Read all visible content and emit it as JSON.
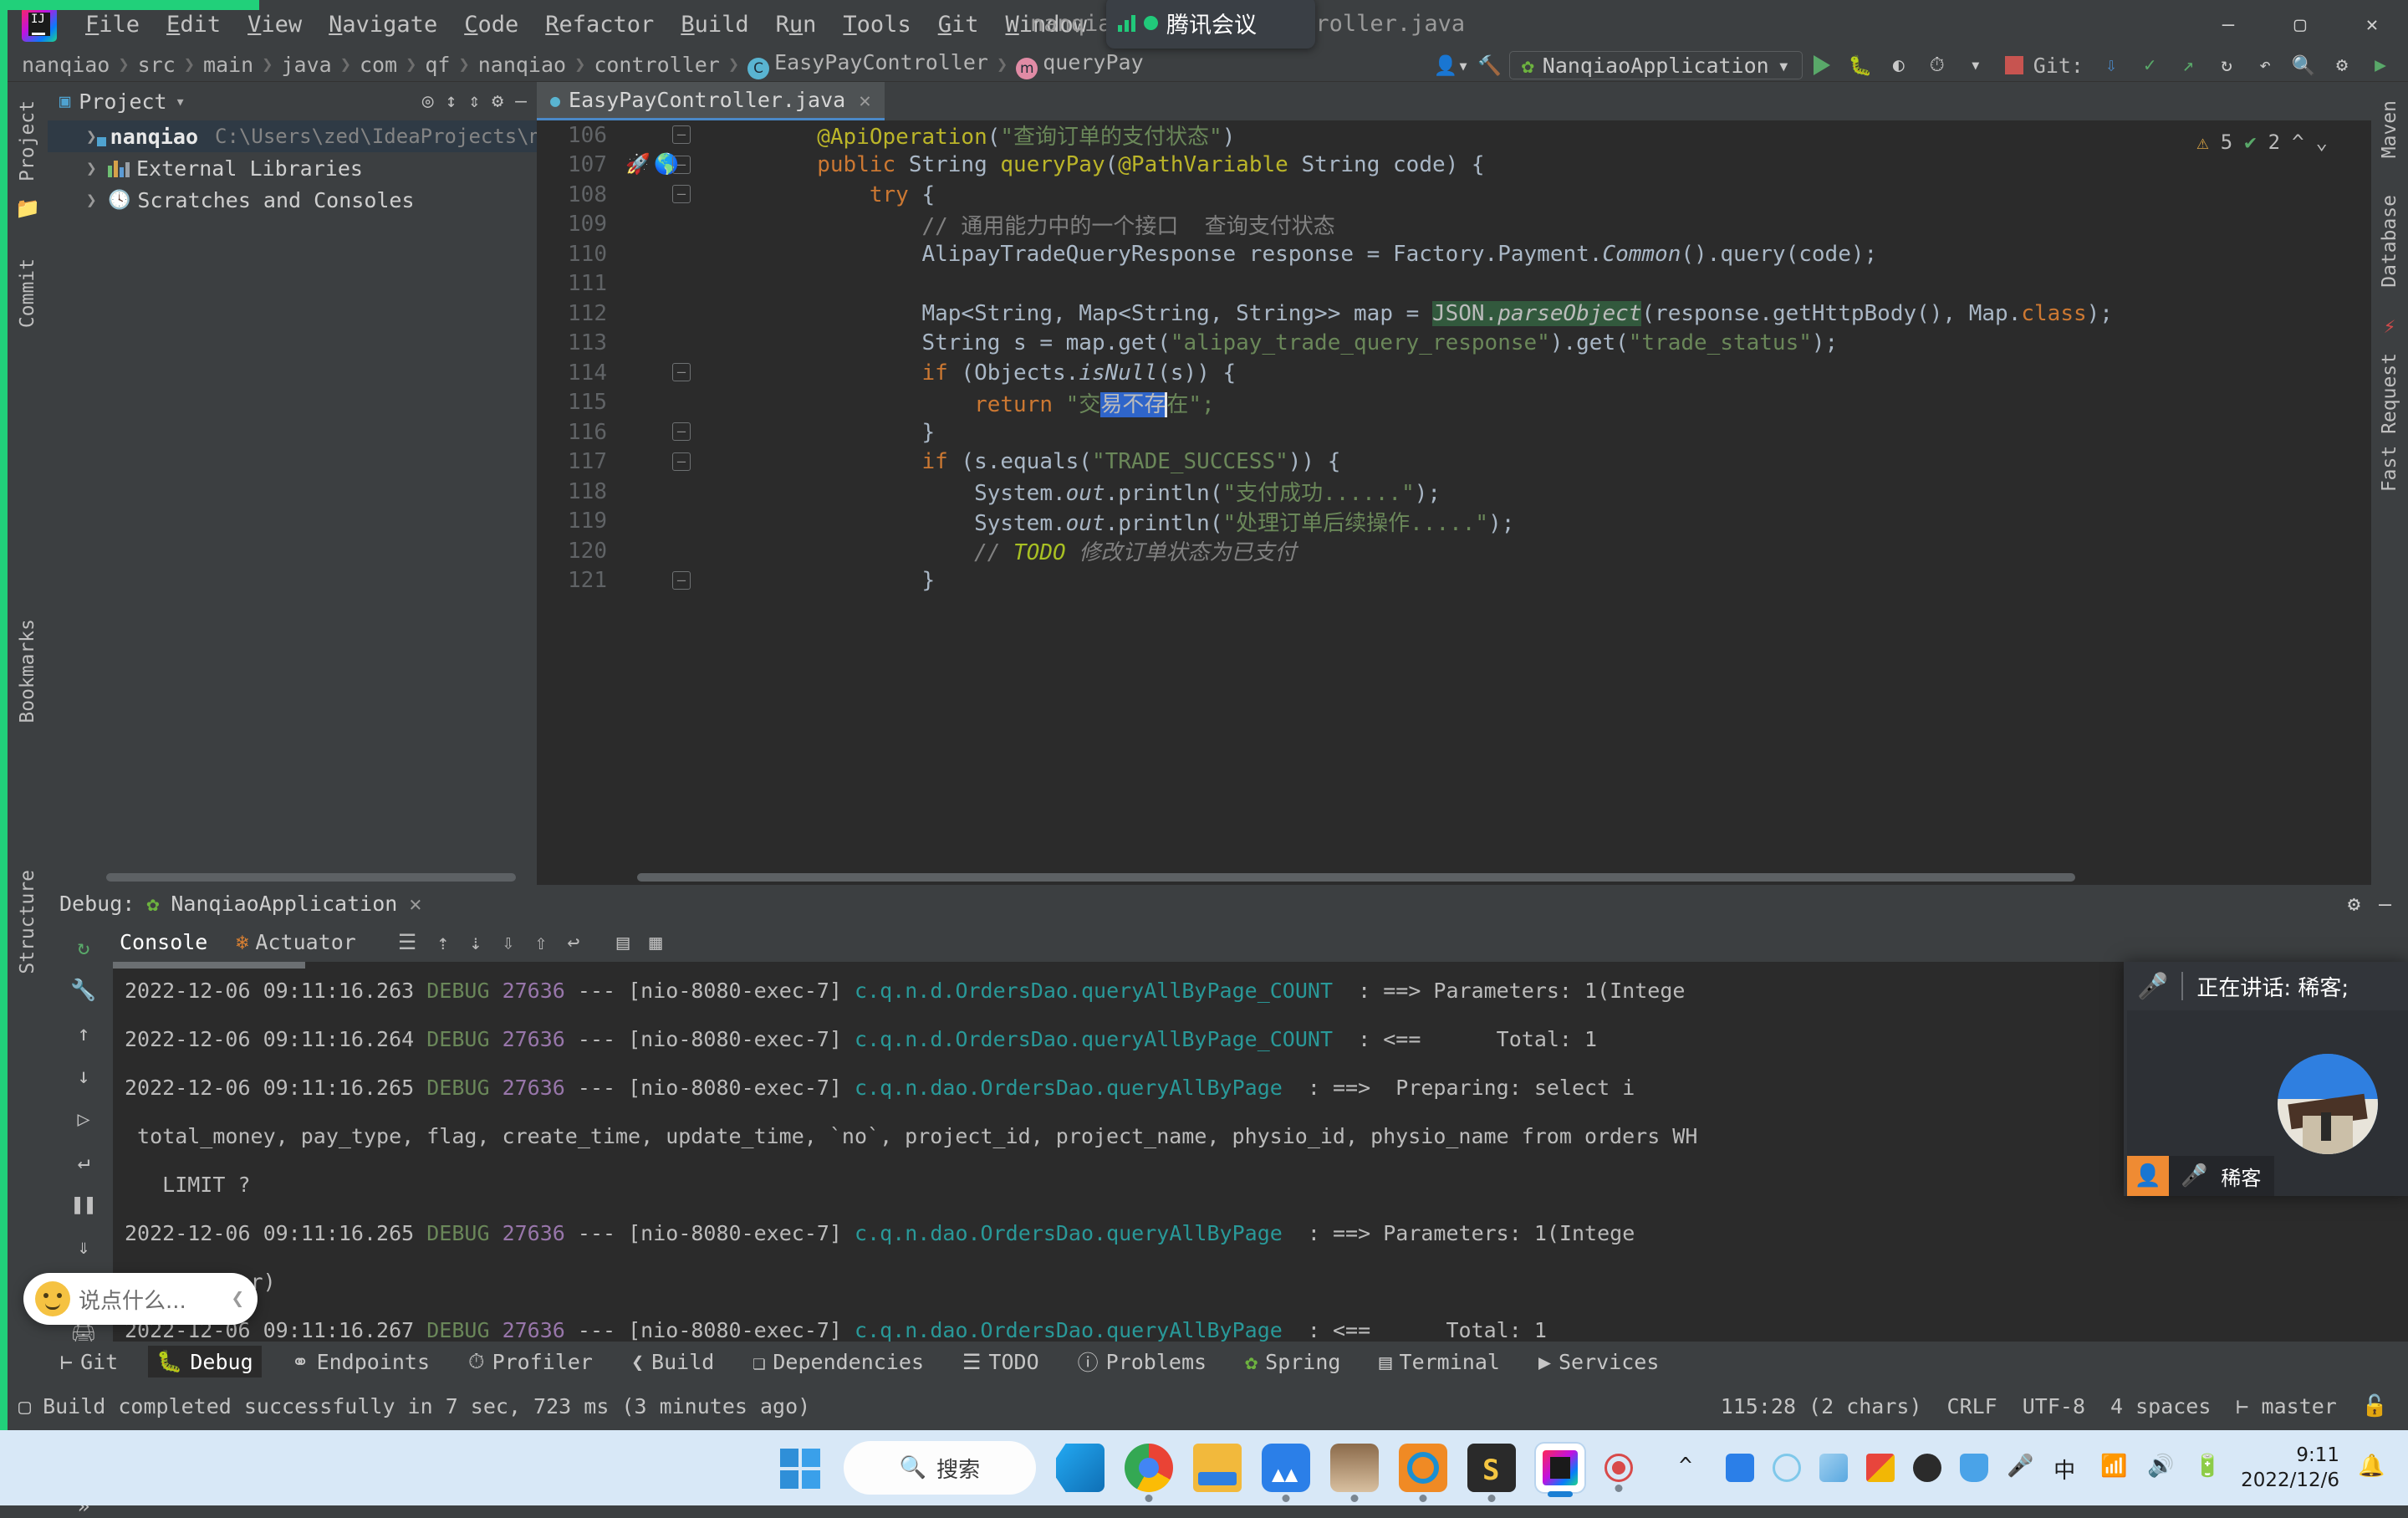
{
  "window": {
    "title": "nanqiao – EasyPayController.java",
    "project_name": "nanqiao",
    "file_name": "EasyPayController.java",
    "minimize": "—",
    "maximize": "▢",
    "close": "✕"
  },
  "menu": {
    "items": [
      {
        "label": "File",
        "mnemonic": "F"
      },
      {
        "label": "Edit",
        "mnemonic": "E"
      },
      {
        "label": "View",
        "mnemonic": "V"
      },
      {
        "label": "Navigate",
        "mnemonic": "N"
      },
      {
        "label": "Code",
        "mnemonic": "C"
      },
      {
        "label": "Refactor",
        "mnemonic": "R"
      },
      {
        "label": "Build",
        "mnemonic": "B"
      },
      {
        "label": "Run",
        "mnemonic": "u"
      },
      {
        "label": "Tools",
        "mnemonic": "T"
      },
      {
        "label": "Git",
        "mnemonic": "G"
      },
      {
        "label": "Window",
        "mnemonic": "W"
      },
      {
        "label": "Help",
        "mnemonic": "H"
      }
    ]
  },
  "tencent_pill": {
    "app_name": "腾讯会议"
  },
  "navbar": {
    "breadcrumbs": [
      "nanqiao",
      "src",
      "main",
      "java",
      "com",
      "qf",
      "nanqiao",
      "controller"
    ],
    "class_crumb": "EasyPayController",
    "class_icon_letter": "C",
    "method_crumb": "queryPay",
    "method_icon_letter": "m",
    "run_config": "NanqiaoApplication",
    "git_label": "Git:",
    "separator": "❯"
  },
  "left_strip": {
    "items": [
      "Project",
      "Commit"
    ]
  },
  "right_strip": {
    "items": [
      "Maven",
      "Database",
      "Fast Request"
    ]
  },
  "bookmarks_strip": {
    "items": [
      "Bookmarks",
      "Structure"
    ]
  },
  "project_panel": {
    "title": "Project",
    "tree": [
      {
        "label": "nanqiao",
        "detail": "C:\\Users\\zed\\IdeaProjects\\na",
        "selected": true,
        "icon": "module-icon"
      },
      {
        "label": "External Libraries",
        "detail": "",
        "selected": false,
        "icon": "libraries-icon"
      },
      {
        "label": "Scratches and Consoles",
        "detail": "",
        "selected": false,
        "icon": "scratches-icon"
      }
    ]
  },
  "editor": {
    "tab_label": "EasyPayController.java",
    "warnings": "5",
    "checks": "2",
    "warn_icon": "⚠",
    "check_icon": "✔",
    "lines": [
      {
        "num": "106",
        "fold": "minus",
        "gutter": "",
        "tokens": [
          {
            "t": "        ",
            "c": "id"
          },
          {
            "t": "@ApiOperation",
            "c": "anno"
          },
          {
            "t": "(",
            "c": "id"
          },
          {
            "t": "\"查询订单的支付状态\"",
            "c": "str"
          },
          {
            "t": ")",
            "c": "id"
          }
        ]
      },
      {
        "num": "107",
        "fold": "minus",
        "gutter": "rocket-globe",
        "tokens": [
          {
            "t": "        ",
            "c": "id"
          },
          {
            "t": "public ",
            "c": "kw"
          },
          {
            "t": "String ",
            "c": "id"
          },
          {
            "t": "queryPay",
            "c": "anno"
          },
          {
            "t": "(",
            "c": "id"
          },
          {
            "t": "@PathVariable ",
            "c": "anno"
          },
          {
            "t": "String code) {",
            "c": "id"
          }
        ]
      },
      {
        "num": "108",
        "fold": "minus",
        "gutter": "",
        "tokens": [
          {
            "t": "            ",
            "c": "id"
          },
          {
            "t": "try",
            "c": "kw"
          },
          {
            "t": " {",
            "c": "id"
          }
        ]
      },
      {
        "num": "109",
        "fold": "",
        "gutter": "",
        "tokens": [
          {
            "t": "                ",
            "c": "id"
          },
          {
            "t": "// 通用能力中的一个接口  查询支付状态",
            "c": "cmt"
          }
        ]
      },
      {
        "num": "110",
        "fold": "",
        "gutter": "",
        "tokens": [
          {
            "t": "                AlipayTradeQueryResponse response = Factory.Payment.",
            "c": "id"
          },
          {
            "t": "Common",
            "c": "stat"
          },
          {
            "t": "().query(code);",
            "c": "id"
          }
        ]
      },
      {
        "num": "111",
        "fold": "",
        "gutter": "",
        "tokens": [
          {
            "t": "",
            "c": "id"
          }
        ]
      },
      {
        "num": "112",
        "fold": "",
        "gutter": "",
        "tokens": [
          {
            "t": "                Map<String, Map<String, String>> map = ",
            "c": "id"
          },
          {
            "t": "JSON.",
            "c": "hl"
          },
          {
            "t": "parseObject",
            "c": "hl-i"
          },
          {
            "t": "(response.getHttpBody(), Map.",
            "c": "id"
          },
          {
            "t": "class",
            "c": "kw"
          },
          {
            "t": ");",
            "c": "id"
          }
        ]
      },
      {
        "num": "113",
        "fold": "",
        "gutter": "",
        "tokens": [
          {
            "t": "                String s = map.get(",
            "c": "id"
          },
          {
            "t": "\"alipay_trade_query_response\"",
            "c": "str"
          },
          {
            "t": ").get(",
            "c": "id"
          },
          {
            "t": "\"trade_status\"",
            "c": "str"
          },
          {
            "t": ");",
            "c": "id"
          }
        ]
      },
      {
        "num": "114",
        "fold": "minus",
        "gutter": "",
        "tokens": [
          {
            "t": "                ",
            "c": "id"
          },
          {
            "t": "if",
            "c": "kw"
          },
          {
            "t": " (Objects.",
            "c": "id"
          },
          {
            "t": "isNull",
            "c": "stat"
          },
          {
            "t": "(s)) {",
            "c": "id"
          }
        ]
      },
      {
        "num": "115",
        "fold": "",
        "gutter": "",
        "current": true,
        "tokens": [
          {
            "t": "                    ",
            "c": "id"
          },
          {
            "t": "return",
            "c": "kw"
          },
          {
            "t": " \"交",
            "c": "str"
          },
          {
            "t": "易不存",
            "c": "sel"
          },
          {
            "t": "caret",
            "c": "caret"
          },
          {
            "t": "在\";",
            "c": "str"
          }
        ]
      },
      {
        "num": "116",
        "fold": "minus",
        "gutter": "",
        "tokens": [
          {
            "t": "                }",
            "c": "id"
          }
        ]
      },
      {
        "num": "117",
        "fold": "minus",
        "gutter": "",
        "tokens": [
          {
            "t": "                ",
            "c": "id"
          },
          {
            "t": "if",
            "c": "kw"
          },
          {
            "t": " (s.equals(",
            "c": "id"
          },
          {
            "t": "\"TRADE_SUCCESS\"",
            "c": "str"
          },
          {
            "t": ")) {",
            "c": "id"
          }
        ]
      },
      {
        "num": "118",
        "fold": "",
        "gutter": "",
        "tokens": [
          {
            "t": "                    System.",
            "c": "id"
          },
          {
            "t": "out",
            "c": "stat"
          },
          {
            "t": ".println(",
            "c": "id"
          },
          {
            "t": "\"支付成功......\"",
            "c": "str"
          },
          {
            "t": ");",
            "c": "id"
          }
        ]
      },
      {
        "num": "119",
        "fold": "",
        "gutter": "",
        "tokens": [
          {
            "t": "                    System.",
            "c": "id"
          },
          {
            "t": "out",
            "c": "stat"
          },
          {
            "t": ".println(",
            "c": "id"
          },
          {
            "t": "\"处理订单后续操作.....\"",
            "c": "str"
          },
          {
            "t": ");",
            "c": "id"
          }
        ]
      },
      {
        "num": "120",
        "fold": "",
        "gutter": "",
        "tokens": [
          {
            "t": "                    ",
            "c": "id"
          },
          {
            "t": "// ",
            "c": "cmt-i"
          },
          {
            "t": "TODO",
            "c": "todo"
          },
          {
            "t": " 修改订单状态为已支付",
            "c": "cmt-i"
          }
        ]
      },
      {
        "num": "121",
        "fold": "minus",
        "gutter": "",
        "tokens": [
          {
            "t": "                }",
            "c": "id"
          }
        ]
      }
    ]
  },
  "debug_panel": {
    "label": "Debug:",
    "session": "NanqiaoApplication",
    "close_icon": "✕",
    "tabs": [
      {
        "label": "Console",
        "active": true
      },
      {
        "label": "Actuator",
        "active": false
      }
    ],
    "console_lines": [
      {
        "date": "2022-12-06",
        "time": "09:11:16.263",
        "level": "DEBUG",
        "pid": "27636",
        "sep": "---",
        "thread": "[nio-8080-exec-7]",
        "logger": "c.q.n.d.OrdersDao.queryAllByPage_COUNT",
        "msg": ": ==> Parameters: 1(Intege",
        "partial": true
      },
      {
        "date": "2022-12-06",
        "time": "09:11:16.264",
        "level": "DEBUG",
        "pid": "27636",
        "sep": "---",
        "thread": "[nio-8080-exec-7]",
        "logger": "c.q.n.d.OrdersDao.queryAllByPage_COUNT",
        "msg": ": <==      Total: 1"
      },
      {
        "date": "2022-12-06",
        "time": "09:11:16.265",
        "level": "DEBUG",
        "pid": "27636",
        "sep": "---",
        "thread": "[nio-8080-exec-7]",
        "logger": "c.q.n.dao.OrdersDao.queryAllByPage",
        "msg": ": ==>  Preparing: select i"
      },
      {
        "continuation": " total_money, pay_type, flag, create_time, update_time, `no`, project_id, project_name, physio_id, physio_name from orders WH"
      },
      {
        "continuation": "   LIMIT ?"
      },
      {
        "date": "2022-12-06",
        "time": "09:11:16.265",
        "level": "DEBUG",
        "pid": "27636",
        "sep": "---",
        "thread": "[nio-8080-exec-7]",
        "logger": "c.q.n.dao.OrdersDao.queryAllByPage",
        "msg": ": ==> Parameters: 1(Intege"
      },
      {
        "continuation": " 10(Integer)"
      },
      {
        "date": "2022-12-06",
        "time": "09:11:16.267",
        "level": "DEBUG",
        "pid": "27636",
        "sep": "---",
        "thread": "[nio-8080-exec-7]",
        "logger": "c.q.n.dao.OrdersDao.queryAllByPage",
        "msg": ": <==      Total: 1"
      }
    ]
  },
  "bottom_bar": {
    "items": [
      {
        "label": "Git",
        "icon": "git-branch-icon",
        "active": false
      },
      {
        "label": "Debug",
        "icon": "bug-icon",
        "active": true
      },
      {
        "label": "Endpoints",
        "icon": "endpoints-icon",
        "active": false
      },
      {
        "label": "Profiler",
        "icon": "profiler-icon",
        "active": false
      },
      {
        "label": "Build",
        "icon": "build-icon",
        "active": false
      },
      {
        "label": "Dependencies",
        "icon": "dependencies-icon",
        "active": false
      },
      {
        "label": "TODO",
        "icon": "todo-icon",
        "active": false
      },
      {
        "label": "Problems",
        "icon": "problems-icon",
        "active": false
      },
      {
        "label": "Spring",
        "icon": "spring-icon",
        "active": false
      },
      {
        "label": "Terminal",
        "icon": "terminal-icon",
        "active": false
      },
      {
        "label": "Services",
        "icon": "services-icon",
        "active": false
      }
    ]
  },
  "status_bar": {
    "message": "Build completed successfully in 7 sec, 723 ms (3 minutes ago)",
    "caret": "115:28 (2 chars)",
    "line_sep": "CRLF",
    "encoding": "UTF-8",
    "indent": "4 spaces",
    "branch": "master",
    "branch_icon": "git-branch-icon",
    "lock_icon": "lock-icon"
  },
  "tencent_window": {
    "speaking_label": "正在讲话: 稀客;",
    "participant_name": "稀客",
    "mic_icon": "microphone-icon",
    "person_icon": "person-icon"
  },
  "ime_popup": {
    "hint": "说点什么...",
    "chevron": "❮"
  },
  "taskbar": {
    "search_placeholder": "搜索",
    "apps": [
      {
        "name": "start-button",
        "running": false
      },
      {
        "name": "vscode-icon",
        "running": false
      },
      {
        "name": "chrome-icon",
        "running": true
      },
      {
        "name": "file-explorer-icon",
        "running": false
      },
      {
        "name": "tencent-meeting-icon",
        "running": true
      },
      {
        "name": "user-photo-icon",
        "running": true
      },
      {
        "name": "navicat-icon",
        "running": true
      },
      {
        "name": "sublime-icon",
        "running": true
      },
      {
        "name": "intellij-idea-icon",
        "running": true,
        "focused": true
      },
      {
        "name": "recording-icon",
        "running": true
      }
    ],
    "tray": [
      "chevron-up-icon",
      "tencent-meeting-icon",
      "circle-icon",
      "wallpaper-icon",
      "office-icon",
      "qq-icon",
      "security-shield-icon",
      "microphone-icon",
      "ime-chinese-icon",
      "wifi-icon",
      "volume-icon",
      "battery-icon"
    ],
    "clock_time": "9:11",
    "clock_date": "2022/12/6",
    "notification_icon": "bell-sleep-icon"
  }
}
